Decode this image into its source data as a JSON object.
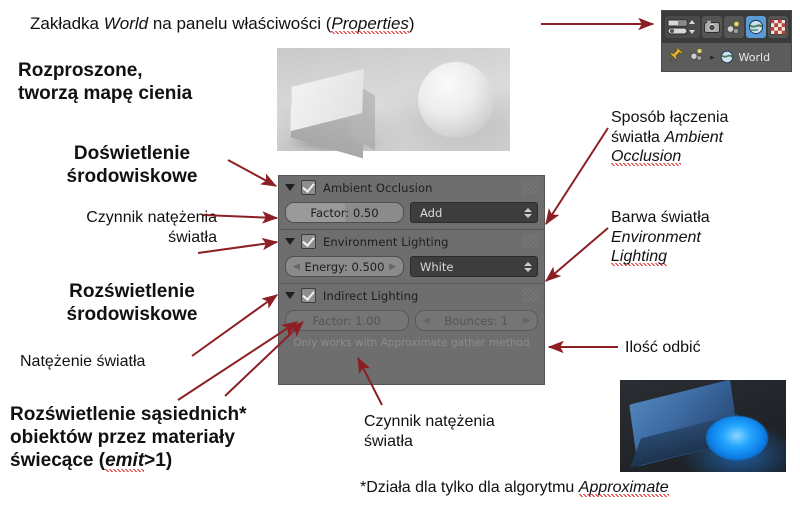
{
  "title": "Blender World properties annotated tutorial (Polish)",
  "annotations": {
    "top_caption_pre": "Zakładka ",
    "top_caption_em1": "World",
    "top_caption_mid": " na panelu właściwości (",
    "top_caption_em2": "Properties",
    "top_caption_post": ")",
    "diffuse_title": "Rozproszone,\ntworzą mapę cienia",
    "diffuse_line1": "Rozproszone,",
    "diffuse_line2": "tworzą mapę cienia",
    "ao_heading_line1": "Doświetlenie",
    "ao_heading_line2": "środowiskowe",
    "ao_factor_line1": "Czynnik natężenia",
    "ao_factor_line2": "światła",
    "env_heading_line1": "Rozświetlenie",
    "env_heading_line2": "środowiskowe",
    "env_energy": "Natężenie światła",
    "indirect_line1": "Rozświetlenie sąsiednich*",
    "indirect_line2": "obiektów przez materiały",
    "indirect_line3_pre": "świecące (",
    "indirect_line3_em": "emit",
    "indirect_line3_post": ">1)",
    "blend_line1": "Sposób łączenia",
    "blend_line2_pre": "światła ",
    "blend_line2_em": "Ambient",
    "blend_line3_em": "Occlusion",
    "color_line1": "Barwa światła",
    "color_line2_em": "Environment",
    "color_line3_em": "Lighting",
    "bounces_label": "Ilość odbić",
    "indirect_factor_line1": "Czynnik natężenia",
    "indirect_factor_line2": "światła",
    "footnote_pre": "*Działa dla tylko dla algorytmu ",
    "footnote_em": "Approximate"
  },
  "properties_header": {
    "tabs": [
      {
        "name": "render-layers-group-icon",
        "active": false
      },
      {
        "name": "render-camera-icon",
        "active": false
      },
      {
        "name": "scene-icon",
        "active": false
      },
      {
        "name": "world-icon",
        "active": true
      },
      {
        "name": "texture-icon",
        "active": false
      }
    ],
    "breadcrumb": {
      "pin_icon": "pin-icon",
      "datablock_icon": "world-data-icon",
      "separator": "▸",
      "label": "World"
    }
  },
  "panel": {
    "sections": [
      {
        "id": "ambient-occlusion",
        "title": "Ambient Occlusion",
        "checked": true,
        "expanded": true,
        "widgets": [
          {
            "type": "slider",
            "label": "Factor: 0.50",
            "fill_percent": 50,
            "dim": false
          },
          {
            "type": "dropdown",
            "label": "Add"
          }
        ]
      },
      {
        "id": "environment-lighting",
        "title": "Environment Lighting",
        "checked": true,
        "expanded": true,
        "widgets": [
          {
            "type": "stepper",
            "label": "Energy: 0.500",
            "dim": false
          },
          {
            "type": "dropdown",
            "label": "White"
          }
        ]
      },
      {
        "id": "indirect-lighting",
        "title": "Indirect Lighting",
        "checked": true,
        "expanded": true,
        "widgets": [
          {
            "type": "slider",
            "label": "Factor: 1.00",
            "fill_percent": 0,
            "dim": true
          },
          {
            "type": "stepper",
            "label": "Bounces: 1",
            "dim": true
          }
        ],
        "note": "Only works with Approximate gather method"
      }
    ]
  },
  "colors": {
    "arrow": "#8c1f24",
    "panel_bg": "#6e6e6e",
    "dropdown_bg": "#3d3d3d",
    "tab_active": "#5b9bd5",
    "spellcheck_underline": "#dd3333"
  },
  "renders": {
    "top": {
      "name": "grey-ambient-occlusion-render",
      "alt": "Grey cube and sphere lit by ambient occlusion"
    },
    "bottom": {
      "name": "blue-indirect-lighting-render",
      "alt": "Blue plane lit by glowing emissive sphere"
    }
  }
}
